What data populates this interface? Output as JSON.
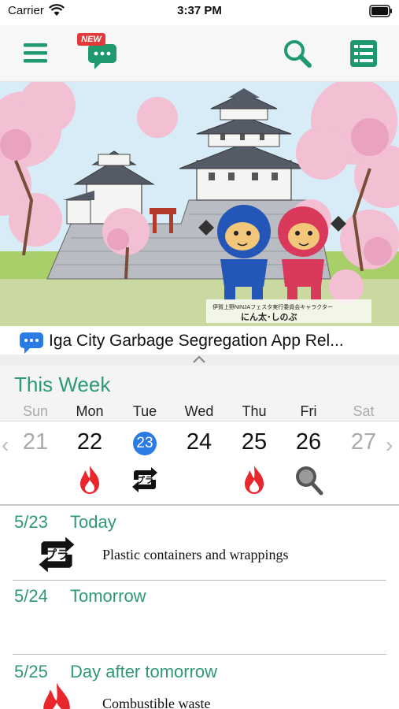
{
  "status_bar": {
    "carrier": "Carrier",
    "time": "3:37 PM"
  },
  "toolbar": {
    "new_badge": "NEW",
    "icons": [
      "menu-icon",
      "chat-new-icon",
      "search-icon",
      "list-icon"
    ],
    "accent": "#1e9a6e"
  },
  "banner": {
    "caption_small": "伊賀上野NINJAフェスタ実行委員会キャラクター",
    "caption_names": "にん太･しのぶ"
  },
  "news": {
    "text": "Iga City Garbage Segregation App Rel..."
  },
  "week": {
    "title": "This Week",
    "days": [
      {
        "dow": "Sun",
        "date": "21",
        "dim": true,
        "icon": ""
      },
      {
        "dow": "Mon",
        "date": "22",
        "dim": false,
        "icon": "fire-icon"
      },
      {
        "dow": "Tue",
        "date": "23",
        "dim": false,
        "today": true,
        "icon": "plastic-recycle-icon"
      },
      {
        "dow": "Wed",
        "date": "24",
        "dim": false,
        "icon": ""
      },
      {
        "dow": "Thu",
        "date": "25",
        "dim": false,
        "icon": "fire-icon"
      },
      {
        "dow": "Fri",
        "date": "26",
        "dim": false,
        "icon": "magnifier-icon"
      },
      {
        "dow": "Sat",
        "date": "27",
        "dim": true,
        "icon": ""
      }
    ],
    "prev_arrow": "‹",
    "next_arrow": "›"
  },
  "schedule": [
    {
      "date": "5/23",
      "relative": "Today",
      "item": "Plastic containers and wrappings",
      "icon": "plastic-recycle-icon"
    },
    {
      "date": "5/24",
      "relative": "Tomorrow",
      "item": "",
      "icon": ""
    },
    {
      "date": "5/25",
      "relative": "Day after tomorrow",
      "item": "Combustible waste",
      "icon": "fire-icon"
    }
  ],
  "colors": {
    "green": "#2f9a72",
    "today_blue": "#2a7be4",
    "fire_red": "#e8262c",
    "chat_blue": "#2a7be4"
  }
}
